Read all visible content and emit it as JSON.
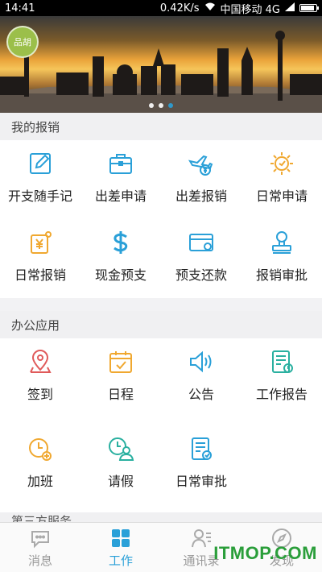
{
  "status_bar": {
    "time": "14:41",
    "speed": "0.42K/s",
    "carrier": "中国移动 4G"
  },
  "banner": {
    "badge": "品胡",
    "dots": 3,
    "active_dot": 2
  },
  "sections": [
    {
      "title": "我的报销",
      "items": [
        {
          "label": "开支随手记",
          "icon": "edit-icon",
          "color": "#2aa0d8"
        },
        {
          "label": "出差申请",
          "icon": "briefcase-icon",
          "color": "#2aa0d8"
        },
        {
          "label": "出差报销",
          "icon": "plane-yen-icon",
          "color": "#2aa0d8"
        },
        {
          "label": "日常申请",
          "icon": "sun-icon",
          "color": "#f0a830"
        },
        {
          "label": "日常报销",
          "icon": "yen-document-icon",
          "color": "#f0a830"
        },
        {
          "label": "现金预支",
          "icon": "dollar-icon",
          "color": "#2aa0d8"
        },
        {
          "label": "预支还款",
          "icon": "card-icon",
          "color": "#2aa0d8"
        },
        {
          "label": "报销审批",
          "icon": "stamp-icon",
          "color": "#2aa0d8"
        }
      ]
    },
    {
      "title": "办公应用",
      "items": [
        {
          "label": "签到",
          "icon": "location-icon",
          "color": "#e05a5a"
        },
        {
          "label": "日程",
          "icon": "calendar-icon",
          "color": "#f0a830"
        },
        {
          "label": "公告",
          "icon": "speaker-icon",
          "color": "#2aa0d8"
        },
        {
          "label": "工作报告",
          "icon": "report-icon",
          "color": "#2ab0a0"
        },
        {
          "label": "加班",
          "icon": "clock-plus-icon",
          "color": "#f0a830"
        },
        {
          "label": "请假",
          "icon": "user-clock-icon",
          "color": "#2ab0a0"
        },
        {
          "label": "日常审批",
          "icon": "approval-doc-icon",
          "color": "#2aa0d8"
        }
      ]
    }
  ],
  "partial_section_title": "第三方服务",
  "tabs": [
    {
      "label": "消息",
      "icon": "chat-icon",
      "active": false
    },
    {
      "label": "工作",
      "icon": "grid-icon",
      "active": true
    },
    {
      "label": "通讯录",
      "icon": "contacts-icon",
      "active": false
    },
    {
      "label": "发现",
      "icon": "compass-icon",
      "active": false
    }
  ],
  "watermark": "ITMOP.COM",
  "colors": {
    "accent": "#2aa0d8",
    "orange": "#f0a830",
    "red": "#e05a5a",
    "teal": "#2ab0a0"
  }
}
